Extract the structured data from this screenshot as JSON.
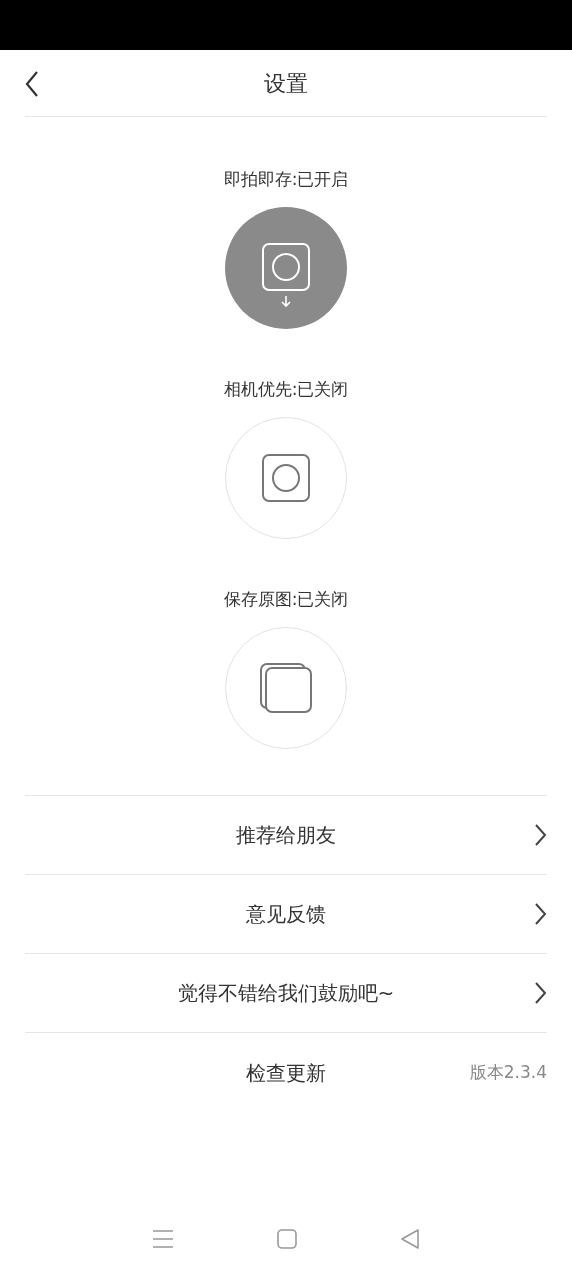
{
  "header": {
    "title": "设置"
  },
  "toggles": [
    {
      "label": "即拍即存:已开启",
      "kind": "camera-save",
      "on": true
    },
    {
      "label": "相机优先:已关闭",
      "kind": "camera",
      "on": false
    },
    {
      "label": "保存原图:已关闭",
      "kind": "layers",
      "on": false
    }
  ],
  "menu": [
    {
      "label": "推荐给朋友",
      "kind": "link"
    },
    {
      "label": "意见反馈",
      "kind": "link"
    },
    {
      "label": "觉得不错给我们鼓励吧~",
      "kind": "link"
    },
    {
      "label": "检查更新",
      "kind": "version",
      "value": "版本2.3.4"
    }
  ]
}
